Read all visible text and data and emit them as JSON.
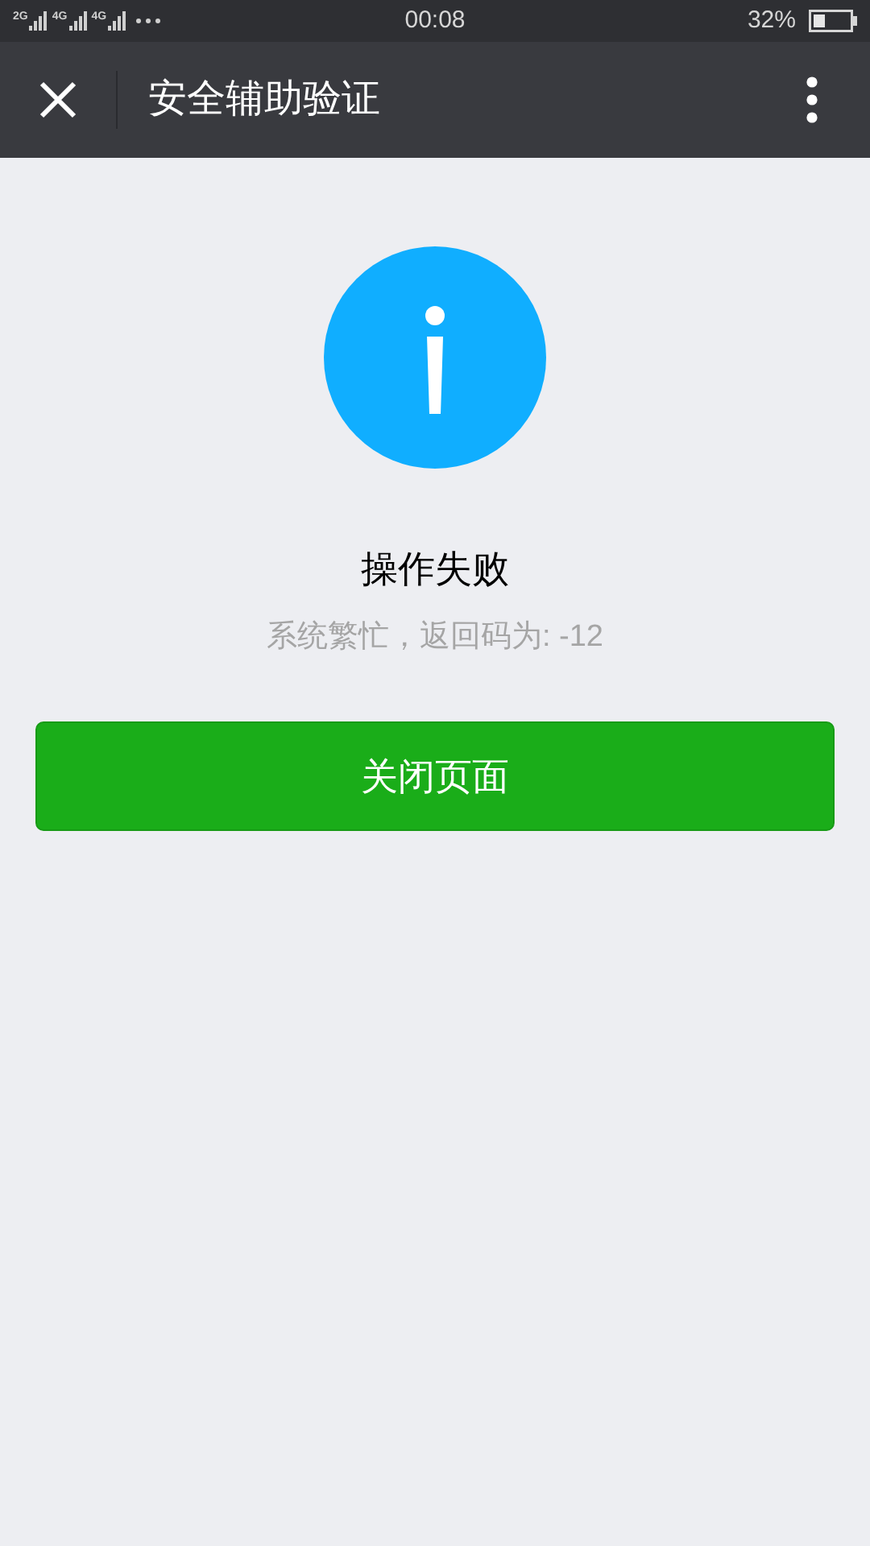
{
  "status_bar": {
    "networks": [
      "2G",
      "4G",
      "4G"
    ],
    "time": "00:08",
    "battery": "32%"
  },
  "nav_bar": {
    "title": "安全辅助验证"
  },
  "result": {
    "kind": "info",
    "title": "操作失败",
    "message": "系统繁忙，返回码为: -12"
  },
  "buttons": [
    {
      "label": "关闭页面",
      "kind": "primary"
    }
  ]
}
